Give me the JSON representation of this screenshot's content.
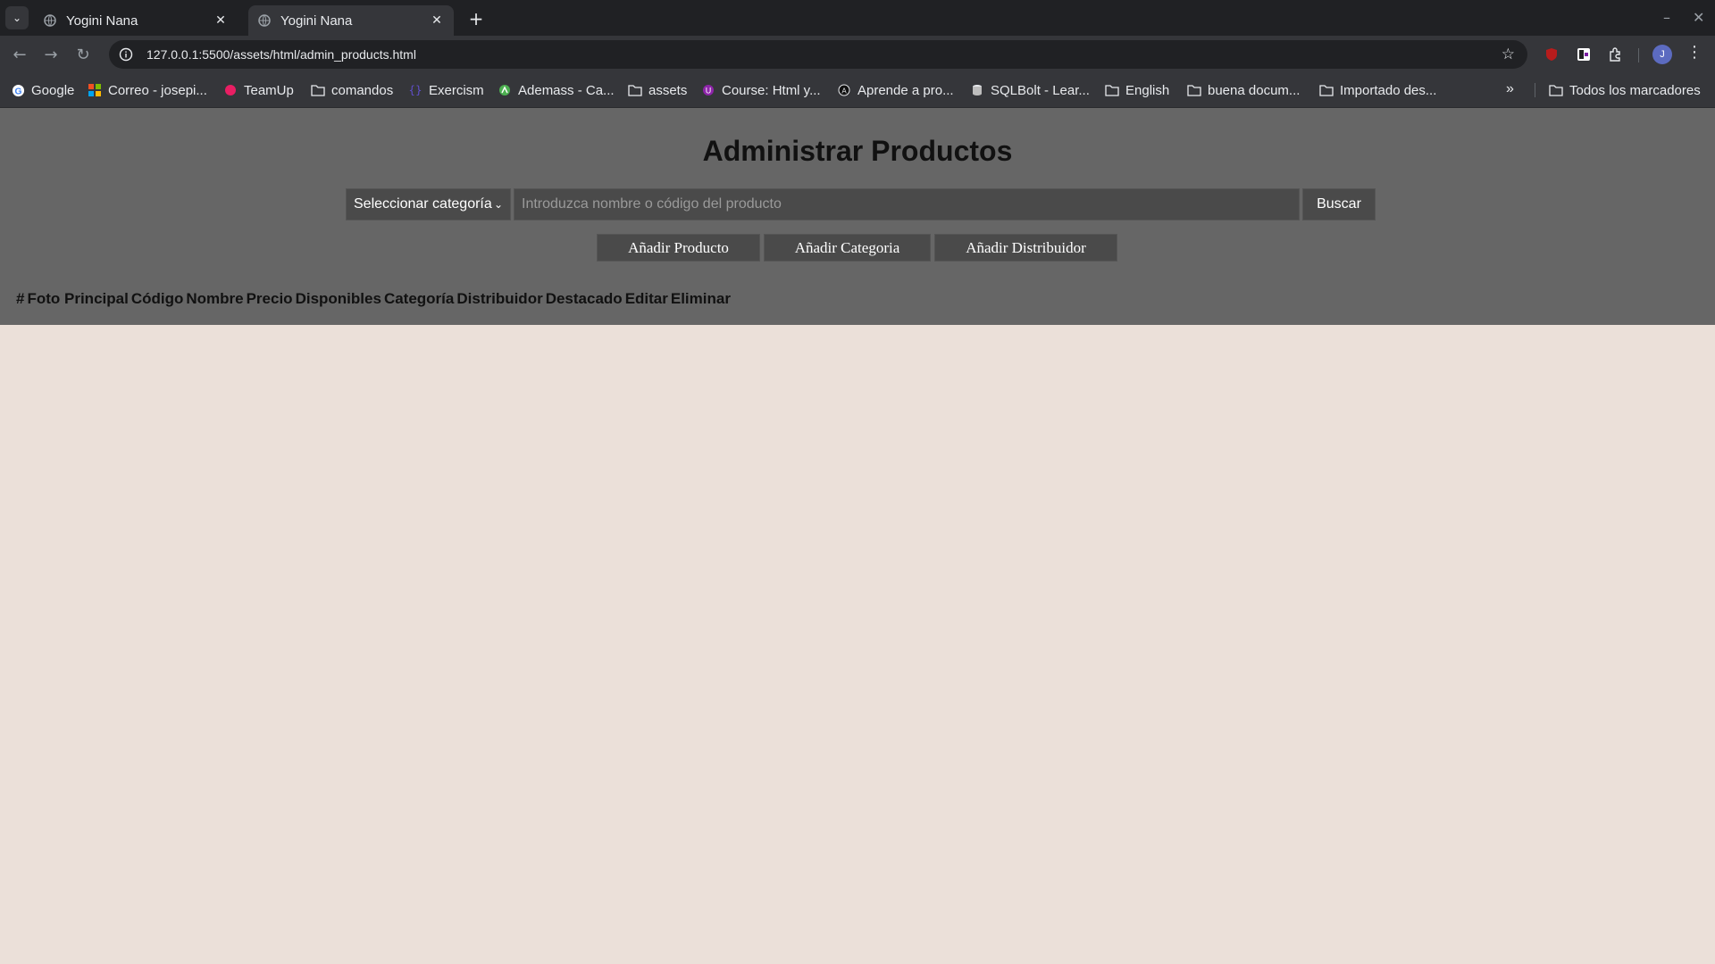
{
  "browser": {
    "tabs": [
      {
        "title": "Yogini Nana",
        "active": false
      },
      {
        "title": "Yogini Nana",
        "active": true
      }
    ],
    "url": "127.0.0.1:5500/assets/html/admin_products.html",
    "profile_initial": "J",
    "bookmarks": [
      {
        "label": "Google",
        "icon": "google-icon"
      },
      {
        "label": "Correo - josepi...",
        "icon": "microsoft-icon"
      },
      {
        "label": "TeamUp",
        "icon": "teamup-icon"
      },
      {
        "label": "comandos",
        "icon": "folder-icon"
      },
      {
        "label": "Exercism",
        "icon": "exercism-icon"
      },
      {
        "label": "Ademass - Ca...",
        "icon": "ademass-icon"
      },
      {
        "label": "assets",
        "icon": "folder-icon"
      },
      {
        "label": "Course: Html y...",
        "icon": "course-icon"
      },
      {
        "label": "Aprende a pro...",
        "icon": "aprende-icon"
      },
      {
        "label": "SQLBolt - Lear...",
        "icon": "sqlbolt-icon"
      },
      {
        "label": "English",
        "icon": "folder-icon"
      },
      {
        "label": "buena docum...",
        "icon": "folder-icon"
      },
      {
        "label": "Importado des...",
        "icon": "folder-icon"
      }
    ],
    "all_bookmarks": "Todos los marcadores"
  },
  "page": {
    "title": "Administrar Productos",
    "category_select": "Seleccionar categoría",
    "search_placeholder": "Introduzca nombre o código del producto",
    "search_button": "Buscar",
    "actions": {
      "add_product": "Añadir Producto",
      "add_category": "Añadir Categoria",
      "add_distributor": "Añadir Distribuidor"
    },
    "table_headers": [
      "#",
      "Foto Principal",
      "Código",
      "Nombre",
      "Precio",
      "Disponibles",
      "Categoría",
      "Distribuidor",
      "Destacado",
      "Editar",
      "Eliminar"
    ]
  },
  "colors": {
    "page_header_bg": "#666666",
    "page_bg": "#ebe0d9",
    "control_bg": "#4a4a4a"
  }
}
